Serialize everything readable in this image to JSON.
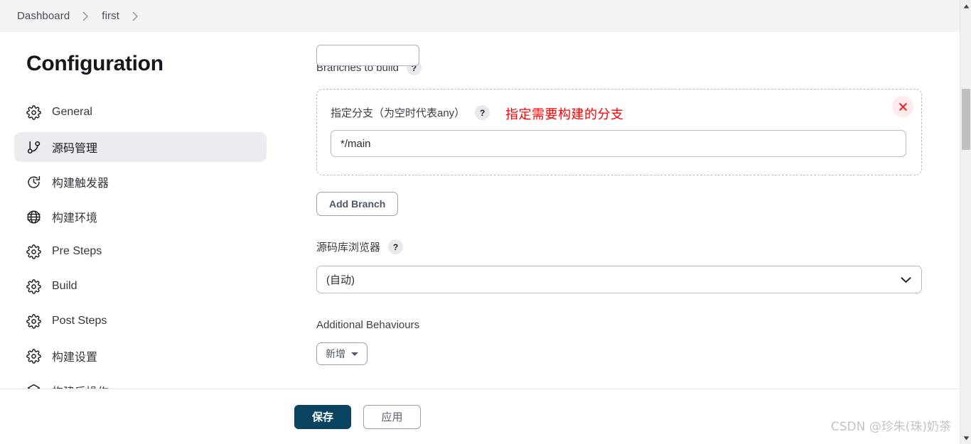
{
  "breadcrumb": {
    "items": [
      {
        "label": "Dashboard"
      },
      {
        "label": "first"
      }
    ],
    "separator_icon": "chevron-right-icon"
  },
  "sidebar": {
    "title": "Configuration",
    "items": [
      {
        "label": "General",
        "icon": "gear-icon",
        "active": false
      },
      {
        "label": "源码管理",
        "icon": "git-branch-icon",
        "active": true
      },
      {
        "label": "构建触发器",
        "icon": "clock-icon",
        "active": false
      },
      {
        "label": "构建环境",
        "icon": "globe-icon",
        "active": false
      },
      {
        "label": "Pre Steps",
        "icon": "gear-icon",
        "active": false
      },
      {
        "label": "Build",
        "icon": "gear-icon",
        "active": false
      },
      {
        "label": "Post Steps",
        "icon": "gear-icon",
        "active": false
      },
      {
        "label": "构建设置",
        "icon": "gear-icon",
        "active": false
      },
      {
        "label": "构建后操作",
        "icon": "box-icon",
        "active": false
      }
    ]
  },
  "main": {
    "branches_to_build": {
      "label": "Branches to build",
      "help_icon": "help-question-icon"
    },
    "branch_entry": {
      "label": "指定分支（为空时代表any）",
      "help_icon": "help-question-icon",
      "annotation": "指定需要构建的分支",
      "annotation_color": "#ff0000",
      "delete_icon": "close-x-icon",
      "input_value": "*/main",
      "input_placeholder": ""
    },
    "add_branch_button": {
      "label": "Add Branch"
    },
    "repository_browser": {
      "label": "源码库浏览器",
      "help_icon": "help-question-icon",
      "selected": "(自动)",
      "chevron_icon": "chevron-down-icon"
    },
    "additional_behaviours": {
      "label": "Additional Behaviours",
      "add_button_label": "新增",
      "caret_icon": "caret-down-icon"
    }
  },
  "footer": {
    "save_label": "保存",
    "apply_label": "应用",
    "save_color": "#0b4460"
  },
  "scrollbar": {
    "up_icon": "triangle-up-icon",
    "down_icon": "triangle-down-icon"
  },
  "watermark": {
    "text": "CSDN @珍朱(珠)奶茶"
  }
}
